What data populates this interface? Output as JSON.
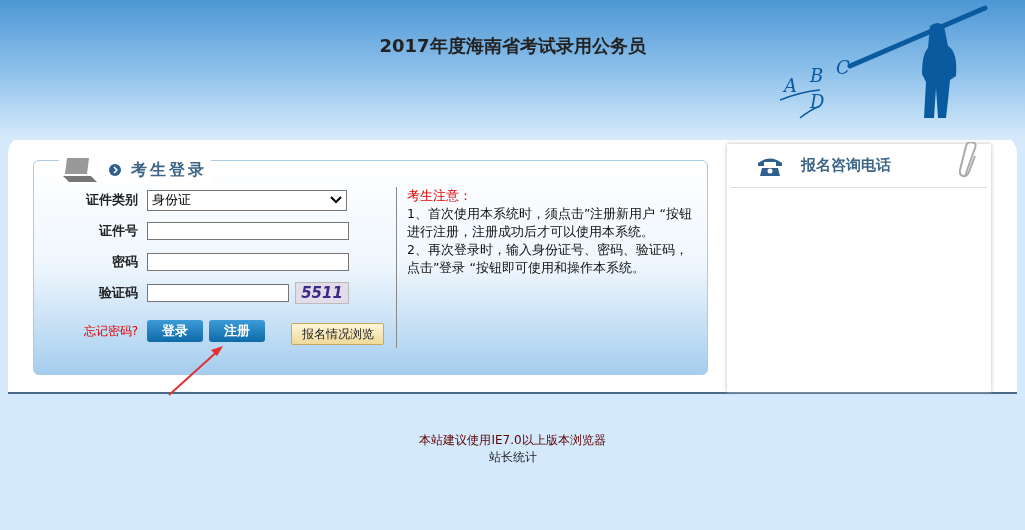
{
  "header": {
    "title": "2017年度海南省考试录用公务员",
    "art_letters": [
      "A",
      "B",
      "C",
      "D"
    ]
  },
  "login": {
    "title": "考生登录",
    "fields": [
      {
        "kind": "select",
        "label": "证件类别",
        "value": "身份证"
      },
      {
        "kind": "text",
        "label": "证件号"
      },
      {
        "kind": "text",
        "label": "密码"
      },
      {
        "kind": "captcha",
        "label": "验证码",
        "captcha": "5511"
      }
    ],
    "forgot": "忘记密码?",
    "login_button": "登录",
    "register_button": "注册",
    "browse_button": "报名情况浏览"
  },
  "notice": {
    "title": "考生注意：",
    "lines": [
      "1、首次使用本系统时，须点击”注册新用户 “按钮进行注册，注册成功后才可以使用本系统。",
      "2、再次登录时，输入身份证号、密码、验证码，点击”登录 “按钮即可使用和操作本系统。"
    ]
  },
  "hotline": {
    "title": "报名咨询电话"
  },
  "footer": {
    "browser_note": "本站建议使用IE7.0以上版本浏览器",
    "stats_link": "站长统计"
  }
}
